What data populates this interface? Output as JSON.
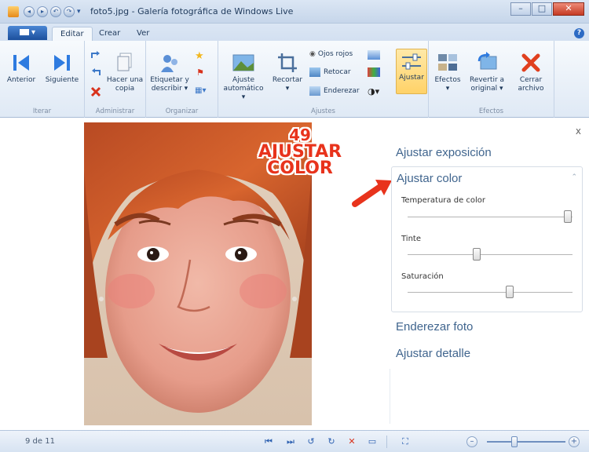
{
  "window": {
    "title": "foto5.jpg - Galería fotográfica de Windows Live"
  },
  "tabs": {
    "app_menu": "▾",
    "items": [
      "Editar",
      "Crear",
      "Ver"
    ],
    "help": "?"
  },
  "ribbon": {
    "navegar": {
      "label": "Iterar",
      "anterior": "Anterior",
      "siguiente": "Siguiente"
    },
    "administrar": {
      "label": "Administrar",
      "copy_line1": "Hacer una",
      "copy_line2": "copia"
    },
    "organizar": {
      "label": "Organizar",
      "tag_line1": "Etiquetar y",
      "tag_line2": "describir ▾"
    },
    "ajustes": {
      "label": "Ajustes",
      "auto_line1": "Ajuste",
      "auto_line2": "automático ▾",
      "recortar_line1": "Recortar",
      "recortar_line2": "▾",
      "ojos_rojos": "Ojos rojos",
      "retocar": "Retocar",
      "enderezar": "Enderezar",
      "ajustar": "Ajustar"
    },
    "efectos": {
      "label": "Efectos",
      "efectos_line1": "Efectos",
      "efectos_line2": "▾",
      "revertir_line1": "Revertir a",
      "revertir_line2": "original ▾",
      "cerrar_line1": "Cerrar",
      "cerrar_line2": "archivo"
    }
  },
  "panel": {
    "close": "x",
    "ajustar_exposicion": "Ajustar exposición",
    "ajustar_color": "Ajustar color",
    "collapse": "⌃",
    "sliders": [
      {
        "label": "Temperatura de color",
        "value": 0.97
      },
      {
        "label": "Tinte",
        "value": 0.42
      },
      {
        "label": "Saturación",
        "value": 0.62
      }
    ],
    "enderezar_foto": "Enderezar foto",
    "ajustar_detalle": "Ajustar detalle"
  },
  "callout": {
    "number": "49",
    "line1": "AJUSTAR",
    "line2": "COLOR"
  },
  "status": {
    "counter": "9 de 11",
    "zoom_level": 0.35
  },
  "colors": {
    "accent": "#40658e",
    "callout": "#e8331c",
    "ribbon_bg": "#dfe9f5"
  }
}
